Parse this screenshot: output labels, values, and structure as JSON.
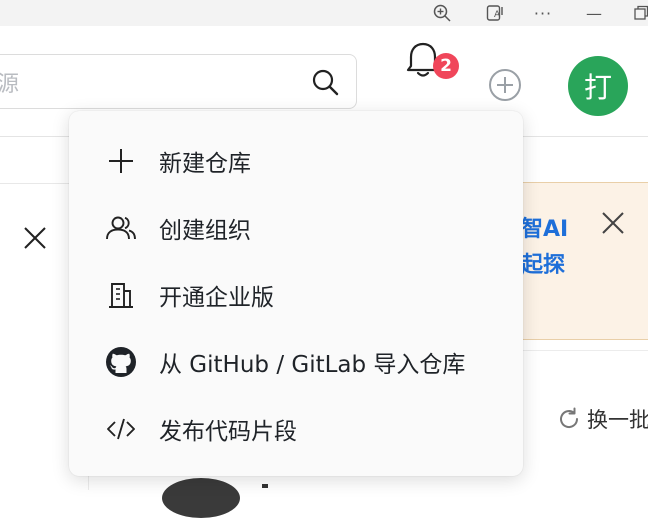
{
  "browser": {
    "icons": [
      "zoom-in-icon",
      "reader-mode-icon",
      "more-icon",
      "minimize-icon",
      "restore-icon"
    ],
    "more_glyph": "···",
    "minimize_glyph": "—"
  },
  "header": {
    "search": {
      "placeholder": "源"
    },
    "notifications": {
      "count": "2"
    },
    "avatar": {
      "initial": "打"
    }
  },
  "menu": {
    "items": [
      {
        "label": "新建仓库",
        "icon": "plus-icon"
      },
      {
        "label": "创建组织",
        "icon": "users-icon"
      },
      {
        "label": "开通企业版",
        "icon": "building-icon"
      },
      {
        "label": "从 GitHub / GitLab 导入仓库",
        "icon": "github-icon"
      },
      {
        "label": "发布代码片段",
        "icon": "code-icon"
      }
    ]
  },
  "promo": {
    "line1": "智AI",
    "line2": "起探"
  },
  "recommend": {
    "refresh_label": "换一批"
  },
  "colors": {
    "accent_blue": "#1e6fd9",
    "avatar_green": "#29a55a",
    "badge_red": "#f0465a",
    "promo_bg": "#fcf2e6"
  }
}
